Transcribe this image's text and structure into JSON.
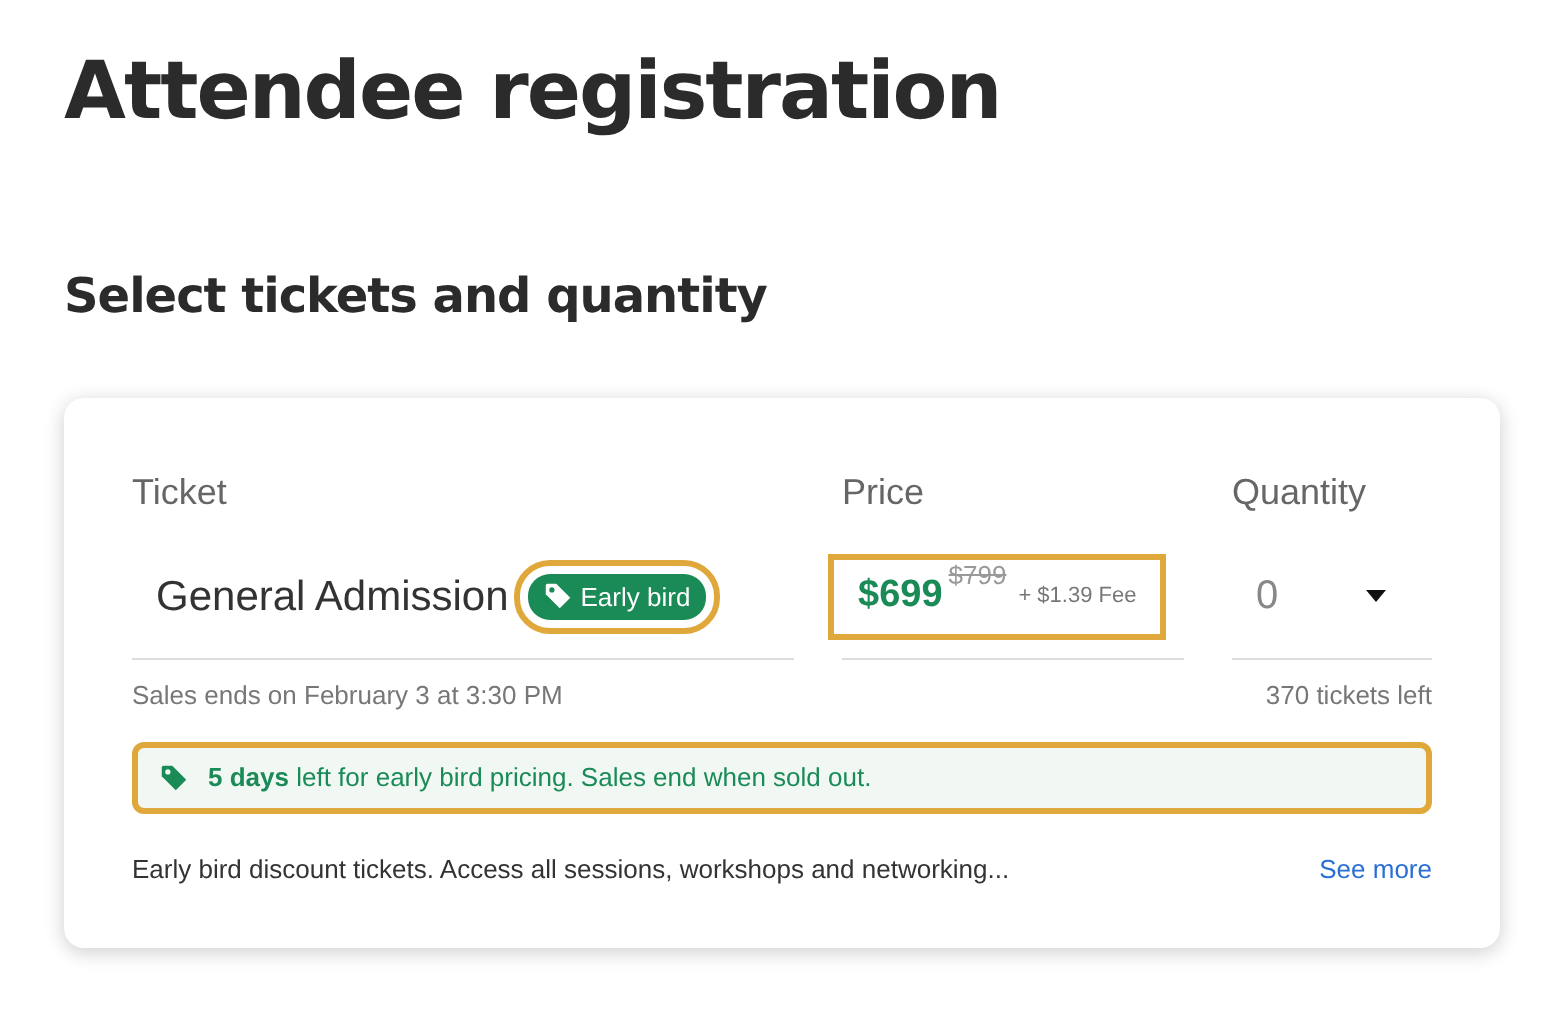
{
  "title": "Attendee registration",
  "subtitle": "Select tickets and quantity",
  "columns": [
    "Ticket",
    "Price",
    "Quantity"
  ],
  "ticket": {
    "name": "General Admission",
    "badge": {
      "label": "Early bird",
      "highlighted": true
    },
    "price": {
      "current": "$699",
      "original": "$799",
      "fee": "+ $1.39 Fee",
      "highlighted": true
    },
    "quantity": "0",
    "sales_end": "Sales ends on February 3 at 3:30 PM",
    "remaining": "370 tickets left",
    "notice": {
      "text": "**5 days** left for early bird pricing. Sales end when sold out.",
      "highlighted": true
    },
    "description": "Early bird discount tickets. Access all sessions, workshops and networking...",
    "link": "See more"
  }
}
